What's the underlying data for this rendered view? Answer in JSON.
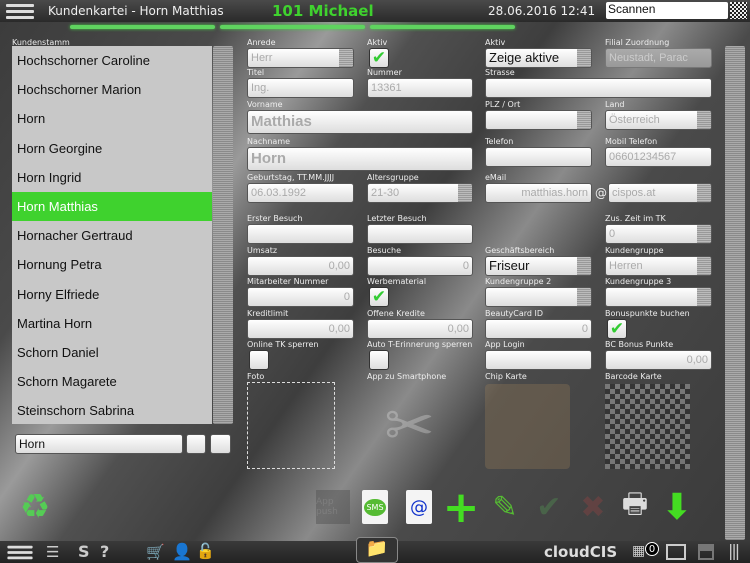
{
  "header": {
    "title": "Kundenkartei - Horn Matthias",
    "user": "101 Michael",
    "datetime": "28.06.2016 12:41",
    "scan_value": "Scannen",
    "accent": "#3fd22e"
  },
  "list": {
    "label": "Kundenstamm",
    "items": [
      "Hochschorner Caroline",
      "Hochschorner Marion",
      "Horn",
      "Horn Georgine",
      "Horn Ingrid",
      "Horn Matthias",
      "Hornacher Gertraud",
      "Hornung Petra",
      "Horny Elfriede",
      "Martina Horn",
      "Schorn Daniel",
      "Schorn Magarete",
      "Steinschorn Sabrina"
    ],
    "selected": "Horn Matthias",
    "search_value": "Horn"
  },
  "form": {
    "anrede": {
      "label": "Anrede",
      "value": "Herr"
    },
    "aktiv_chk": {
      "label": "Aktiv",
      "checked": true
    },
    "aktiv_sel": {
      "label": "Aktiv",
      "value": "Zeige aktive"
    },
    "filiale": {
      "label": "Filial Zuordnung",
      "value": "Neustadt, Parac"
    },
    "titel": {
      "label": "Titel",
      "value": "Ing."
    },
    "nummer": {
      "label": "Nummer",
      "value": "13361"
    },
    "strasse": {
      "label": "Strasse",
      "value": ""
    },
    "vorname": {
      "label": "Vorname",
      "value": "Matthias"
    },
    "plz": {
      "label": "PLZ / Ort",
      "value": ""
    },
    "land": {
      "label": "Land",
      "value": "Österreich"
    },
    "nachname": {
      "label": "Nachname",
      "value": "Horn"
    },
    "telefon": {
      "label": "Telefon",
      "value": ""
    },
    "mobil": {
      "label": "Mobil Telefon",
      "value": "06601234567"
    },
    "geburtstag": {
      "label": "Geburtstag, TT.MM.JJJJ",
      "value": "06.03.1992"
    },
    "altersgruppe": {
      "label": "Altersgruppe",
      "value": "21-30"
    },
    "email": {
      "label": "eMail",
      "value": "matthias.horn",
      "at": "@",
      "domain": "cispos.at"
    },
    "erster": {
      "label": "Erster Besuch",
      "value": ""
    },
    "letzter": {
      "label": "Letzter Besuch",
      "value": ""
    },
    "zuszeit": {
      "label": "Zus. Zeit im TK",
      "value": "0"
    },
    "umsatz": {
      "label": "Umsatz",
      "value": "0,00"
    },
    "besuche": {
      "label": "Besuche",
      "value": "0"
    },
    "geschaeft": {
      "label": "Geschäftsbereich",
      "value": "Friseur"
    },
    "kundengruppe": {
      "label": "Kundengruppe",
      "value": "Herren"
    },
    "mitarbeiter": {
      "label": "Mitarbeiter Nummer",
      "value": "0"
    },
    "werbe": {
      "label": "Werbematerial",
      "checked": true
    },
    "kg2": {
      "label": "Kundengruppe 2",
      "value": ""
    },
    "kg3": {
      "label": "Kundengruppe 3",
      "value": ""
    },
    "kreditlimit": {
      "label": "Kreditlimit",
      "value": "0,00"
    },
    "offene": {
      "label": "Offene Kredite",
      "value": "0,00"
    },
    "beauty": {
      "label": "BeautyCard ID",
      "value": "0"
    },
    "bonusbuchen": {
      "label": "Bonuspunkte buchen",
      "checked": true
    },
    "onlinetk": {
      "label": "Online TK sperren",
      "checked": false
    },
    "autot": {
      "label": "Auto T-Erinnerung sperren",
      "checked": false
    },
    "applogin": {
      "label": "App Login",
      "value": ""
    },
    "bcbonus": {
      "label": "BC Bonus Punkte",
      "value": "0,00"
    },
    "foto": {
      "label": "Foto"
    },
    "app": {
      "label": "App zu Smartphone"
    },
    "chip": {
      "label": "Chip Karte"
    },
    "barcode": {
      "label": "Barcode Karte"
    }
  },
  "toolbar": {
    "app_push": "App push",
    "sms": "SMS",
    "email": "@"
  },
  "bottombar": {
    "brand": "cloudCIS",
    "badge": "0",
    "s": "S",
    "help": "?"
  }
}
